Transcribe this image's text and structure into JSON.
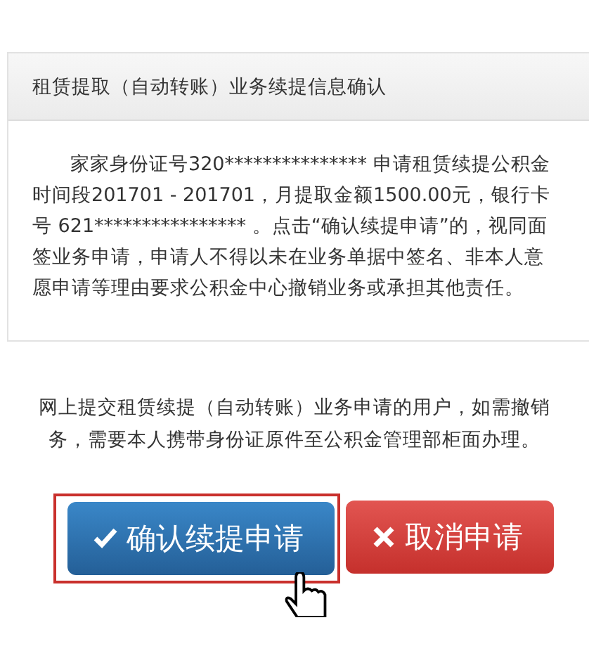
{
  "panel": {
    "title": "租赁提取（自动转账）业务续提信息确认",
    "body": "家家身份证号320*************** 申请租赁续提公积金时间段201701 - 201701，月提取金额1500.00元，银行卡号 621**************** 。点击“确认续提申请”的，视同面签业务申请，申请人不得以未在业务单据中签名、非本人意愿申请等理由要求公积金中心撤销业务或承担其他责任。"
  },
  "notice_lines": [
    "网上提交租赁续提（自动转账）业务申请的用户，如需撤销",
    "务，需要本人携带身份证原件至公积金管理部柜面办理。"
  ],
  "buttons": [
    {
      "kind": "confirm",
      "label": "确认续提申请",
      "focused": true
    },
    {
      "kind": "cancel",
      "label": "取消申请",
      "focused": false
    }
  ]
}
